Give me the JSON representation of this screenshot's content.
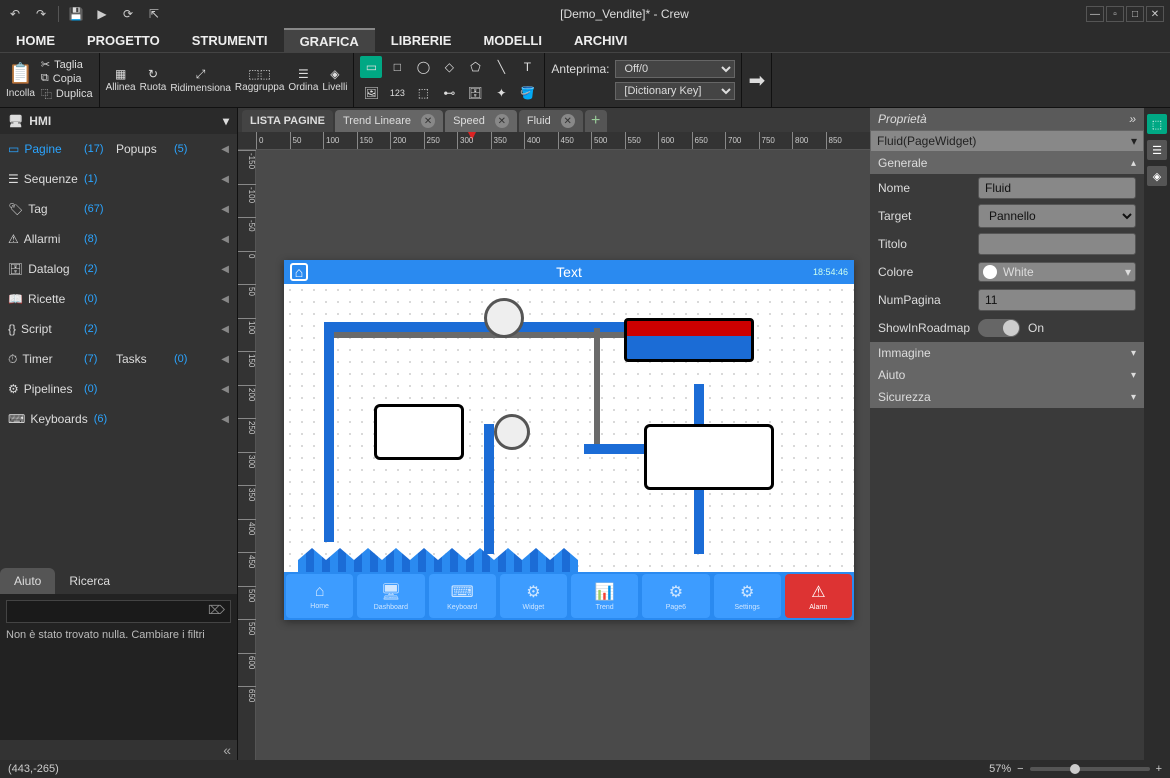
{
  "titlebar": {
    "title": "[Demo_Vendite]* - Crew"
  },
  "menubar": [
    "HOME",
    "PROGETTO",
    "STRUMENTI",
    "GRAFICA",
    "LIBRERIE",
    "MODELLI",
    "ARCHIVI"
  ],
  "menubar_active": 3,
  "ribbon": {
    "paste": "Incolla",
    "clip": {
      "taglia": "Taglia",
      "copia": "Copia",
      "duplica": "Duplica"
    },
    "tools": [
      "Allinea",
      "Ruota",
      "Ridimensiona",
      "Raggruppa",
      "Ordina",
      "Livelli"
    ],
    "anteprima_label": "Anteprima:",
    "anteprima_value": "Off/0",
    "dict_value": "[Dictionary Key]"
  },
  "left": {
    "header": "HMI",
    "items": [
      {
        "name": "Pagine",
        "count": "(17)",
        "sub": "Popups",
        "sct": "(5)",
        "sel": true
      },
      {
        "name": "Sequenze",
        "count": "(1)"
      },
      {
        "name": "Tag",
        "count": "(67)"
      },
      {
        "name": "Allarmi",
        "count": "(8)"
      },
      {
        "name": "Datalog",
        "count": "(2)"
      },
      {
        "name": "Ricette",
        "count": "(0)"
      },
      {
        "name": "Script",
        "count": "(2)"
      },
      {
        "name": "Timer",
        "count": "(7)",
        "sub": "Tasks",
        "sct": "(0)"
      },
      {
        "name": "Pipelines",
        "count": "(0)"
      },
      {
        "name": "Keyboards",
        "count": "(6)"
      }
    ],
    "tabs": [
      "Aiuto",
      "Ricerca"
    ],
    "help_msg": "Non è stato trovato nulla. Cambiare i filtri"
  },
  "tabs": [
    {
      "label": "LISTA PAGINE",
      "hdr": true
    },
    {
      "label": "Trend Lineare",
      "close": true
    },
    {
      "label": "Speed",
      "close": true
    },
    {
      "label": "Fluid",
      "close": true,
      "active": true
    }
  ],
  "page": {
    "title": "Text",
    "timestamp": "18:54:46",
    "nav": [
      "Home",
      "Dashboard",
      "Keyboard",
      "Widget",
      "Trend",
      "Page6",
      "Settings",
      "Alarm"
    ]
  },
  "props": {
    "title": "Proprietà",
    "selection": "Fluid(PageWidget)",
    "sections": {
      "generale": "Generale",
      "immagine": "Immagine",
      "aiuto": "Aiuto",
      "sicurezza": "Sicurezza"
    },
    "rows": {
      "nome": {
        "label": "Nome",
        "value": "Fluid"
      },
      "target": {
        "label": "Target",
        "value": "Pannello"
      },
      "titolo": {
        "label": "Titolo",
        "value": ""
      },
      "colore": {
        "label": "Colore",
        "value": "White"
      },
      "numpagina": {
        "label": "NumPagina",
        "value": "11"
      },
      "showinroadmap": {
        "label": "ShowInRoadmap",
        "value": "On"
      }
    }
  },
  "status": {
    "coords": "(443,-265)",
    "zoom": "57%"
  }
}
